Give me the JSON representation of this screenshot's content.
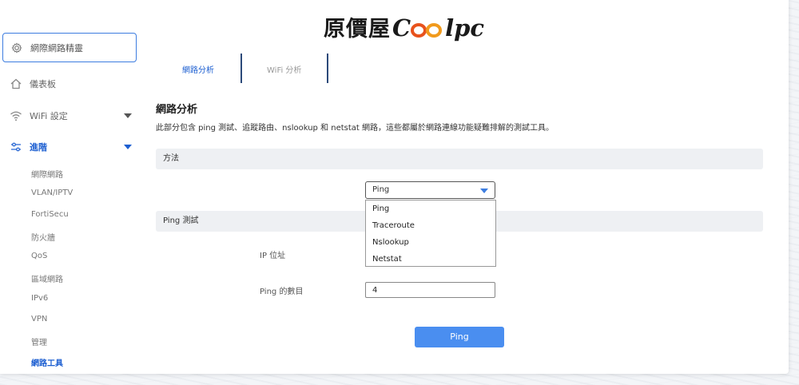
{
  "logo": {
    "cjk": "原價屋",
    "latin_prefix": "C",
    "latin_suffix": "lpc"
  },
  "sidebar": {
    "wizard_label": "網際網路精靈",
    "items": [
      {
        "label": "儀表板",
        "icon": "home-icon"
      },
      {
        "label": "WiFi 設定",
        "icon": "wifi-icon"
      },
      {
        "label": "進階",
        "icon": "sliders-icon"
      }
    ],
    "sub_items": [
      "網際網路",
      "VLAN/IPTV",
      "FortiSecu",
      "防火牆",
      "QoS",
      "區域網路",
      "IPv6",
      "VPN",
      "管理",
      "網路工具"
    ]
  },
  "tabs": [
    "網路分析",
    "WiFi 分析"
  ],
  "main": {
    "title": "網路分析",
    "description": "此部分包含 ping 測試、追蹤路由、nslookup 和 netstat 網路，這些都屬於網路連線功能疑難排解的測試工具。",
    "method_header": "方法",
    "method_selected": "Ping",
    "method_options": [
      "Ping",
      "Traceroute",
      "Nslookup",
      "Netstat"
    ],
    "ping_test_header": "Ping 測試",
    "ip_label": "IP 位址",
    "ip_value": "",
    "count_label": "Ping 的數目",
    "count_value": "4",
    "ping_button": "Ping"
  },
  "colors": {
    "accent": "#1d5fd1",
    "button": "#4a8ef0",
    "divider": "#2c4a7a"
  }
}
